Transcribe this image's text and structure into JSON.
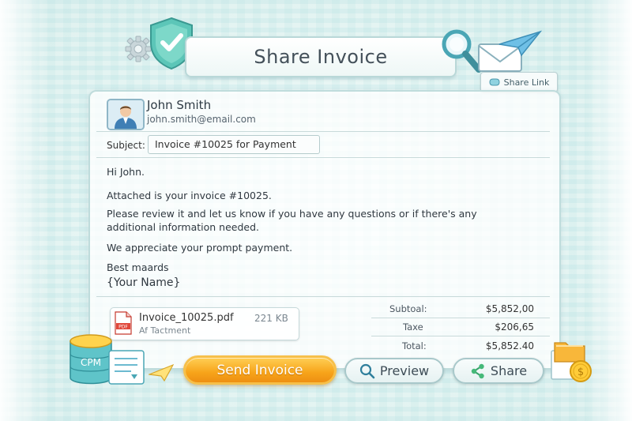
{
  "title": "Share Invoice",
  "share_link": {
    "label": "Share Link",
    "icon": "link-icon"
  },
  "recipient": {
    "name": "John Smith",
    "email": "john.smith@email.com",
    "avatar_icon": "person-avatar-icon"
  },
  "subject": {
    "label": "Subject:",
    "value": "Invoice #10025 for Payment"
  },
  "message": {
    "greeting": "Hi John.",
    "line1": "Attached is your invoice #10025.",
    "line2a": "Please review it and let us know if you have any questions or if there's any",
    "line2b": "additional information needed.",
    "line3": "We appreciate your prompt payment.",
    "closing": "Best maards",
    "signature": "{Your Name}"
  },
  "attachment": {
    "filename": "Invoice_10025.pdf",
    "size": "221 KB",
    "subtitle": "Af Tactment",
    "icon_label": "PDF"
  },
  "totals": {
    "subtotal_label": "Subtoal:",
    "subtotal_value": "$5,852,00",
    "tax_label": "Taxe",
    "tax_value": "$206,65",
    "total_label": "Total:",
    "total_value": "$5,852.40"
  },
  "actions": {
    "send": "Send Invoice",
    "preview": "Preview",
    "share": "Share"
  },
  "decor": {
    "db_label": "CPM"
  },
  "colors": {
    "accent": "#f7a41a",
    "teal": "#57c0b8",
    "border": "#bfdcdc"
  }
}
